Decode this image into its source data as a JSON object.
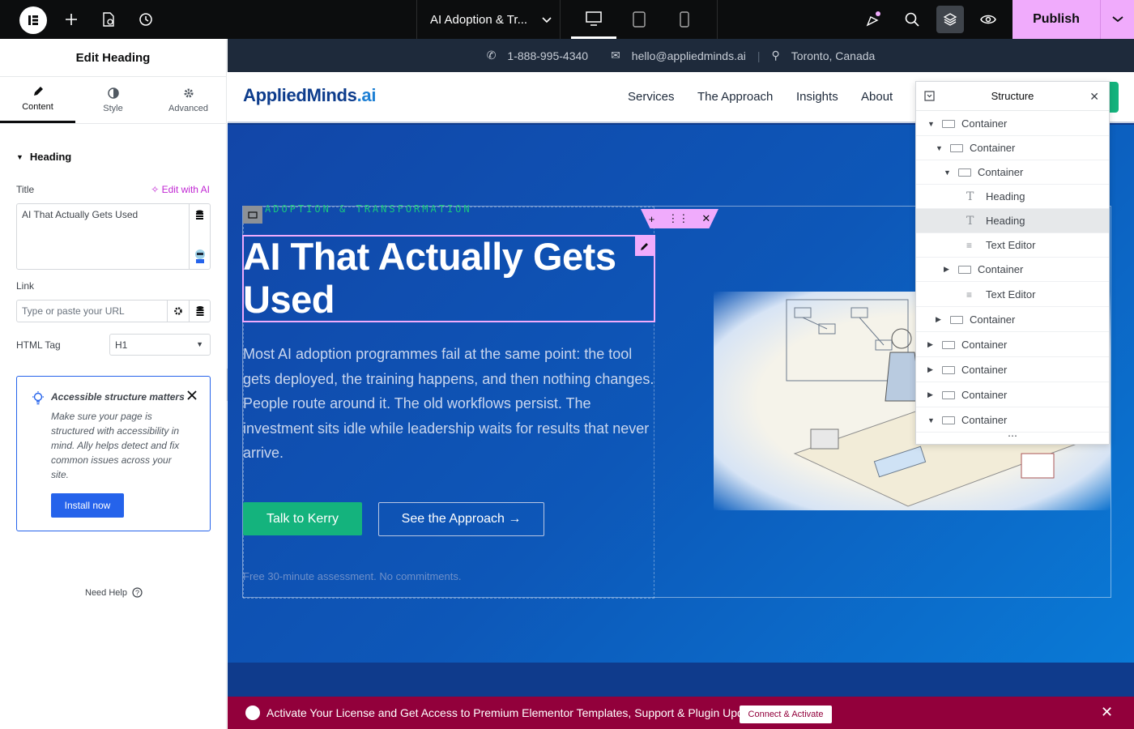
{
  "topbar": {
    "doc_title": "AI Adoption & Tr...",
    "publish_label": "Publish"
  },
  "panel": {
    "title": "Edit Heading",
    "tabs": [
      {
        "label": "Content"
      },
      {
        "label": "Style"
      },
      {
        "label": "Advanced"
      }
    ],
    "section": "Heading",
    "title_label": "Title",
    "edit_ai": "Edit with AI",
    "title_value": "AI That Actually Gets Used",
    "link_label": "Link",
    "link_placeholder": "Type or paste your URL",
    "html_tag_label": "HTML Tag",
    "html_tag_value": "H1",
    "notice_title": "Accessible structure matters",
    "notice_text": "Make sure your page is structured with accessibility in mind. Ally helps detect and fix common issues across your site.",
    "notice_button": "Install now",
    "help": "Need Help"
  },
  "site": {
    "phone": "1-888-995-4340",
    "email": "hello@appliedminds.ai",
    "location": "Toronto, Canada",
    "brand_main": "AppliedMinds",
    "brand_suffix": ".ai",
    "nav": [
      "Services",
      "The Approach",
      "Insights",
      "About"
    ],
    "eyebrow": "ADOPTION & TRANSFORMATION",
    "heading": "AI That Actually Gets Used",
    "paragraph": "Most AI adoption programmes fail at the same point: the tool gets deployed, the training happens, and then nothing changes. People route around it. The old workflows persist. The investment sits idle while leadership waits for results that never arrive.",
    "btn_primary": "Talk to Kerry",
    "btn_secondary": "See the Approach →",
    "footnote": "Free 30-minute assessment. No commitments."
  },
  "banner": {
    "message": "Activate Your License and Get Access to Premium Elementor Templates, Support & Plugin Updates.",
    "action": "Connect & Activate"
  },
  "structure": {
    "title": "Structure",
    "items": [
      {
        "label": "Container",
        "caret": "▼"
      },
      {
        "label": "Container",
        "caret": "▼"
      },
      {
        "label": "Container",
        "caret": "▼"
      },
      {
        "label": "Heading",
        "caret": ""
      },
      {
        "label": "Heading",
        "caret": ""
      },
      {
        "label": "Text Editor",
        "caret": ""
      },
      {
        "label": "Container",
        "caret": "▶"
      },
      {
        "label": "Text Editor",
        "caret": ""
      },
      {
        "label": "Container",
        "caret": "▶"
      },
      {
        "label": "Container",
        "caret": "▶"
      },
      {
        "label": "Container",
        "caret": "▶"
      },
      {
        "label": "Container",
        "caret": "▶"
      },
      {
        "label": "Container",
        "caret": "▼"
      }
    ]
  }
}
